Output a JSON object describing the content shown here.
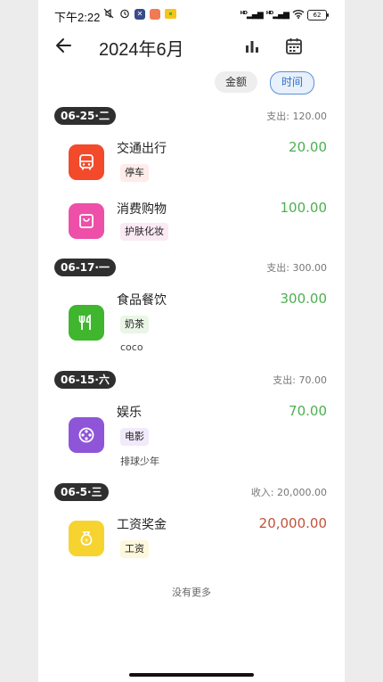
{
  "status": {
    "time": "下午2:22",
    "signal1": "ᴴᴰ",
    "signal2": "ᴴᴰ",
    "battery": "62"
  },
  "header": {
    "title": "2024年6月"
  },
  "toggle": {
    "amount_label": "金额",
    "time_label": "时间",
    "active": "时间"
  },
  "days": [
    {
      "date": "06-25·二",
      "summary": "支出: 120.00",
      "entries": [
        {
          "category": "交通出行",
          "amount": "20.00",
          "tag": "停车",
          "note": "",
          "type": "expense",
          "icon": "bus-icon",
          "color": "#f24a2b"
        },
        {
          "category": "消费购物",
          "amount": "100.00",
          "tag": "护肤化妆",
          "note": "",
          "type": "expense",
          "icon": "shopping-bag-icon",
          "color": "#ee4fa9"
        }
      ]
    },
    {
      "date": "06-17·一",
      "summary": "支出: 300.00",
      "entries": [
        {
          "category": "食品餐饮",
          "amount": "300.00",
          "tag": "奶茶",
          "note": "coco",
          "type": "expense",
          "icon": "fork-knife-icon",
          "color": "#3fb62e"
        }
      ]
    },
    {
      "date": "06-15·六",
      "summary": "支出: 70.00",
      "entries": [
        {
          "category": "娱乐",
          "amount": "70.00",
          "tag": "电影",
          "note": "排球少年",
          "type": "expense",
          "icon": "film-reel-icon",
          "color": "#8e55d8"
        }
      ]
    },
    {
      "date": "06-5·三",
      "summary": "收入: 20,000.00",
      "entries": [
        {
          "category": "工资奖金",
          "amount": "20,000.00",
          "tag": "工资",
          "note": "",
          "type": "income",
          "icon": "money-bag-icon",
          "color": "#f7d330"
        }
      ]
    }
  ],
  "footer": {
    "no_more": "没有更多"
  },
  "colors": {
    "expense": "#4caf50",
    "income": "#c0533b",
    "badge": "#2f2f2f",
    "accent": "#2d6fc7"
  }
}
